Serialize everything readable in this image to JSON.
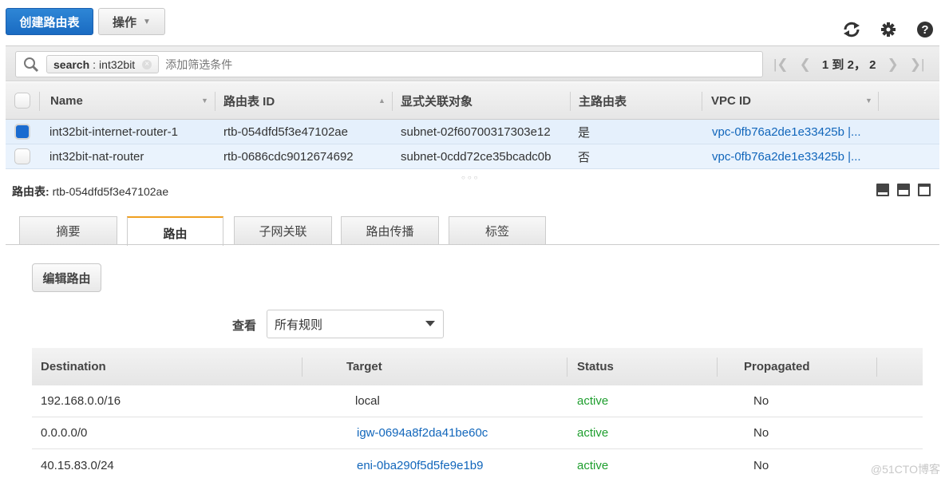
{
  "toolbar": {
    "create_label": "创建路由表",
    "actions_label": "操作",
    "icons": [
      "refresh-icon",
      "gear-icon",
      "help-icon"
    ]
  },
  "filter": {
    "token_key": "search",
    "token_sep": " : ",
    "token_value": "int32bit",
    "placeholder": "添加筛选条件"
  },
  "pagination": {
    "range": "1 到 2，  2"
  },
  "route_tables": {
    "columns": [
      "Name",
      "路由表 ID",
      "显式关联对象",
      "主路由表",
      "VPC ID"
    ],
    "rows": [
      {
        "selected": true,
        "name": "int32bit-internet-router-1",
        "id": "rtb-054dfd5f3e47102ae",
        "assoc": "subnet-02f60700317303e12",
        "main": "是",
        "vpc": "vpc-0fb76a2de1e33425b |..."
      },
      {
        "selected": false,
        "name": "int32bit-nat-router",
        "id": "rtb-0686cdc9012674692",
        "assoc": "subnet-0cdd72ce35bcadc0b",
        "main": "否",
        "vpc": "vpc-0fb76a2de1e33425b |..."
      }
    ]
  },
  "detail": {
    "title_label": "路由表:",
    "title_value": "rtb-054dfd5f3e47102ae",
    "tabs": [
      {
        "label": "摘要",
        "active": false
      },
      {
        "label": "路由",
        "active": true
      },
      {
        "label": "子网关联",
        "active": false
      },
      {
        "label": "路由传播",
        "active": false
      },
      {
        "label": "标签",
        "active": false
      }
    ],
    "edit_routes_label": "编辑路由",
    "view_label": "查看",
    "view_selected": "所有规则"
  },
  "routes": {
    "columns": [
      "Destination",
      "Target",
      "Status",
      "Propagated"
    ],
    "rows": [
      {
        "destination": "192.168.0.0/16",
        "target": "local",
        "target_link": false,
        "status": "active",
        "propagated": "No"
      },
      {
        "destination": "0.0.0.0/0",
        "target": "igw-0694a8f2da41be60c",
        "target_link": true,
        "status": "active",
        "propagated": "No"
      },
      {
        "destination": "40.15.83.0/24",
        "target": "eni-0ba290f5d5fe9e1b9",
        "target_link": true,
        "status": "active",
        "propagated": "No"
      }
    ]
  },
  "colors": {
    "primary": "#1a6bc2",
    "link": "#1166bb",
    "active_status": "#1e9e2e",
    "tab_accent": "#f0a020"
  },
  "watermark": "@51CTO博客"
}
